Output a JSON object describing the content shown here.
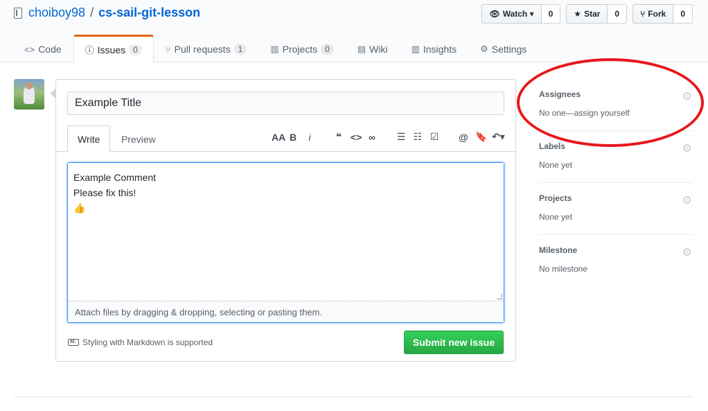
{
  "repo": {
    "owner": "choiboy98",
    "separator": "/",
    "name": "cs-sail-git-lesson"
  },
  "actions": [
    {
      "icon": "eye-icon",
      "label": "Watch ▾",
      "count": "0"
    },
    {
      "icon": "star-icon",
      "label": "Star",
      "count": "0"
    },
    {
      "icon": "fork-icon",
      "label": "Fork",
      "count": "0"
    }
  ],
  "tabs": [
    {
      "icon": "code-icon",
      "label": "Code",
      "counter": ""
    },
    {
      "icon": "issue-icon",
      "label": "Issues",
      "counter": "0"
    },
    {
      "icon": "pull-request-icon",
      "label": "Pull requests",
      "counter": "1"
    },
    {
      "icon": "project-icon",
      "label": "Projects",
      "counter": "0"
    },
    {
      "icon": "wiki-icon",
      "label": "Wiki",
      "counter": ""
    },
    {
      "icon": "graph-icon",
      "label": "Insights",
      "counter": ""
    },
    {
      "icon": "gear-icon",
      "label": "Settings",
      "counter": ""
    }
  ],
  "form": {
    "title_value": "Example Title",
    "write_tab": "Write",
    "preview_tab": "Preview",
    "comment_lines": [
      "Example Comment",
      "Please fix this!",
      "👍"
    ],
    "drop_hint": "Attach files by dragging & dropping, selecting or pasting them.",
    "markdown_note": "Styling with Markdown is supported",
    "submit_label": "Submit new issue"
  },
  "sidebar": [
    {
      "heading": "Assignees",
      "value": "No one—assign yourself"
    },
    {
      "heading": "Labels",
      "value": "None yet"
    },
    {
      "heading": "Projects",
      "value": "None yet"
    },
    {
      "heading": "Milestone",
      "value": "No milestone"
    }
  ],
  "colors": {
    "link": "#0366d6",
    "submit": "#28a745",
    "annotation": "#e8161b",
    "active_tab_border": "#e36209"
  }
}
